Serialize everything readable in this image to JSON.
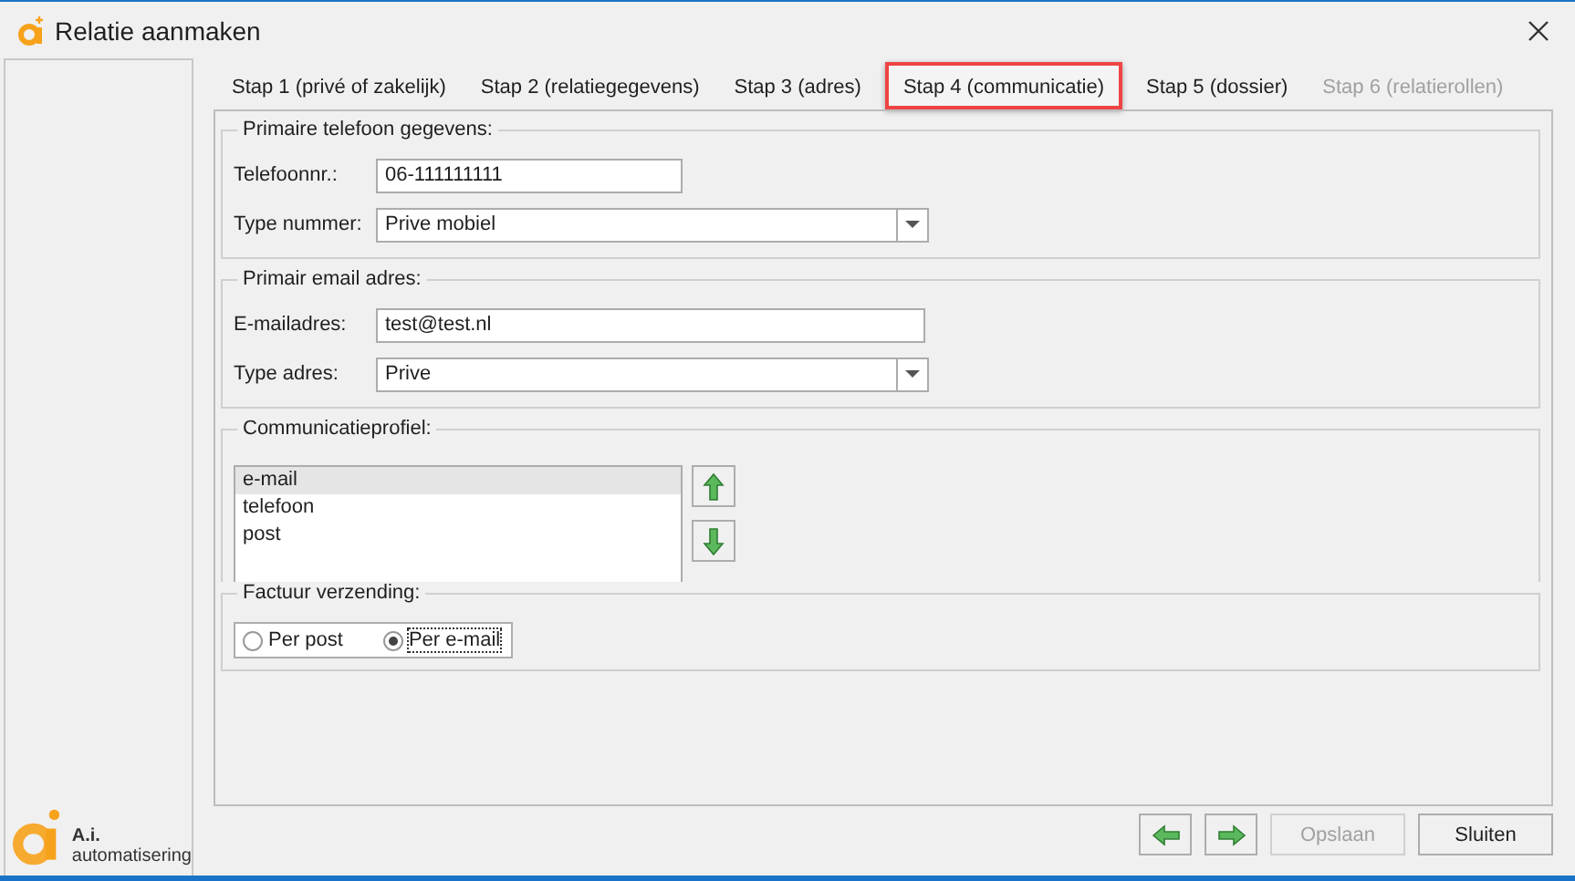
{
  "window": {
    "title": "Relatie aanmaken"
  },
  "brand": {
    "name": "A.i.",
    "tagline": "automatisering"
  },
  "tabs": [
    {
      "label": "Stap 1 (privé of zakelijk)",
      "selected": false,
      "disabled": false
    },
    {
      "label": "Stap 2 (relatiegegevens)",
      "selected": false,
      "disabled": false
    },
    {
      "label": "Stap 3 (adres)",
      "selected": false,
      "disabled": false
    },
    {
      "label": "Stap 4 (communicatie)",
      "selected": true,
      "disabled": false
    },
    {
      "label": "Stap 5 (dossier)",
      "selected": false,
      "disabled": false
    },
    {
      "label": "Stap 6 (relatierollen)",
      "selected": false,
      "disabled": true
    }
  ],
  "phone": {
    "legend": "Primaire telefoon gegevens:",
    "fields": [
      {
        "kind": "text",
        "label": "Telefoonnr.:",
        "value": "06-111111111"
      },
      {
        "kind": "select",
        "label": "Type nummer:",
        "value": "Prive mobiel"
      }
    ]
  },
  "email": {
    "legend": "Primair email adres:",
    "fields": [
      {
        "kind": "wide",
        "label": "E-mailadres:",
        "value": "test@test.nl"
      },
      {
        "kind": "select",
        "label": "Type adres:",
        "value": "Prive"
      }
    ]
  },
  "profile": {
    "legend": "Communicatieprofiel:",
    "items": [
      {
        "label": "e-mail",
        "selected": true
      },
      {
        "label": "telefoon",
        "selected": false
      },
      {
        "label": "post",
        "selected": false
      }
    ]
  },
  "invoice": {
    "legend": "Factuur verzending:",
    "options": [
      {
        "label": "Per post",
        "selected": false
      },
      {
        "label": "Per e-mail",
        "selected": true
      }
    ]
  },
  "buttons": [
    {
      "kind": "prev",
      "disabled": false
    },
    {
      "kind": "next",
      "disabled": false
    },
    {
      "kind": "text",
      "label": "Opslaan",
      "disabled": true
    },
    {
      "kind": "text",
      "label": "Sluiten",
      "disabled": false
    }
  ]
}
